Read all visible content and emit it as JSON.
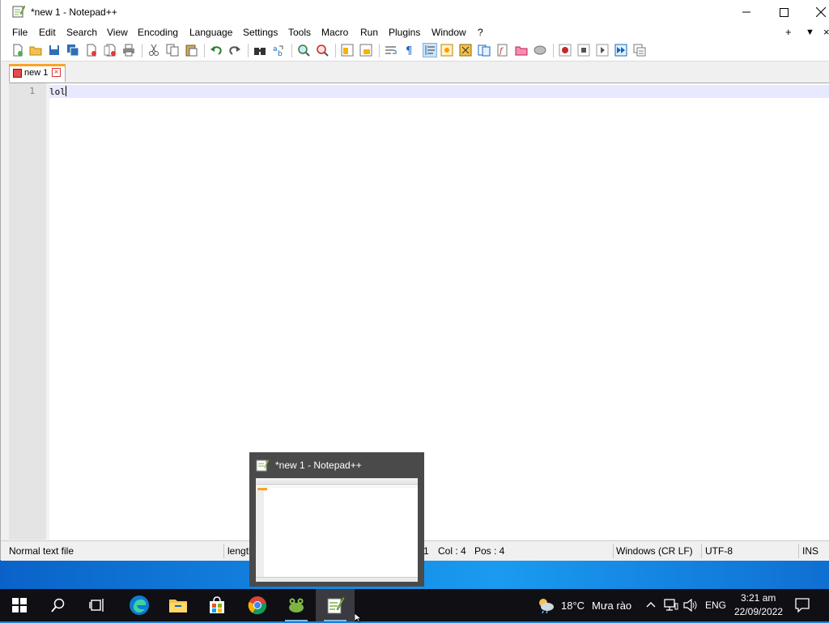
{
  "window": {
    "title": "*new 1 - Notepad++",
    "controls": [
      "minimize",
      "maximize",
      "close"
    ]
  },
  "menu": {
    "items": [
      "File",
      "Edit",
      "Search",
      "View",
      "Encoding",
      "Language",
      "Settings",
      "Tools",
      "Macro",
      "Run",
      "Plugins",
      "Window",
      "?"
    ],
    "right": [
      "+",
      "▼",
      "×"
    ]
  },
  "toolbar": {
    "icons": [
      "new-file-icon",
      "open-file-icon",
      "save-icon",
      "save-all-icon",
      "close-icon",
      "close-all-icon",
      "print-icon",
      "cut-icon",
      "copy-icon",
      "paste-icon",
      "undo-icon",
      "redo-icon",
      "find-icon",
      "replace-icon",
      "zoom-in-icon",
      "zoom-out-icon",
      "sync-vertical-icon",
      "sync-horizontal-icon",
      "word-wrap-icon",
      "show-all-characters-icon",
      "indent-guide-icon",
      "user-defined-language-icon",
      "document-map-icon",
      "document-list-icon",
      "function-list-icon",
      "folder-as-workspace-icon",
      "monitoring-icon",
      "record-macro-icon",
      "stop-recording-icon",
      "playback-macro-icon",
      "run-macro-multiple-icon",
      "save-macro-icon"
    ]
  },
  "tabs": [
    {
      "label": "new 1",
      "modified": true,
      "active": true
    }
  ],
  "editor": {
    "lines": [
      {
        "number": "1",
        "text": "lol"
      }
    ]
  },
  "statusbar": {
    "file_type": "Normal text file",
    "length": "length",
    "ln": "1",
    "col": "Col : 4",
    "pos": "Pos : 4",
    "eol": "Windows (CR LF)",
    "encoding": "UTF-8",
    "mode": "INS"
  },
  "preview": {
    "title": "*new 1 - Notepad++"
  },
  "taskbar": {
    "apps": [
      "start-icon",
      "search-icon",
      "task-view-icon",
      "edge-icon",
      "file-explorer-icon",
      "store-icon",
      "chrome-icon",
      "frog-app-icon",
      "notepadpp-icon"
    ],
    "weather_temp": "18°C",
    "weather_text": "Mưa rào",
    "language": "ENG",
    "time": "3:21 am",
    "date": "22/09/2022"
  },
  "colors": {
    "tab_accent": "#f9a327",
    "current_line": "#e8e8ff",
    "taskbar": "#0f0f14"
  }
}
